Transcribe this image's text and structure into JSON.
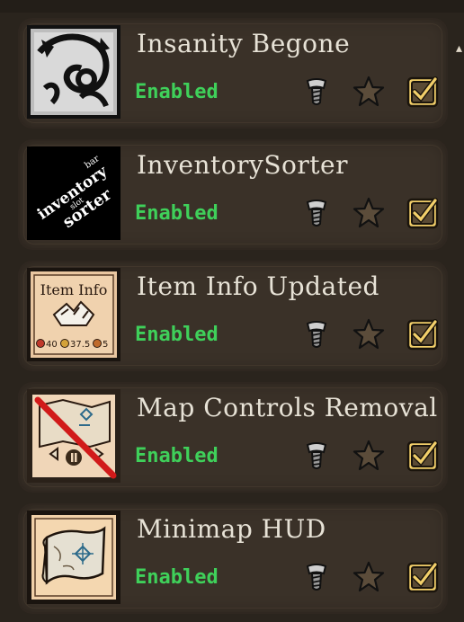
{
  "mods": [
    {
      "title": "Insanity Begone",
      "status": "Enabled",
      "thumb": "dark-creature-emblem",
      "config_icon": "screw-icon",
      "favorite_icon": "star-icon",
      "enabled_icon": "checkbox-checked-icon"
    },
    {
      "title": "InventorySorter",
      "status": "Enabled",
      "thumb": "inventory-sorter-logo",
      "logo_text": {
        "line1": "inventory",
        "line2": "bar",
        "line3": "slot",
        "line4": "sorter"
      },
      "config_icon": "screw-icon",
      "favorite_icon": "star-icon",
      "enabled_icon": "checkbox-checked-icon"
    },
    {
      "title": "Item Info Updated",
      "status": "Enabled",
      "thumb": "item-info-card",
      "card_text": {
        "heading": "Item Info",
        "n1": "40",
        "n2": "37.5",
        "n3": "5"
      },
      "config_icon": "screw-icon",
      "favorite_icon": "star-icon",
      "enabled_icon": "checkbox-checked-icon"
    },
    {
      "title": "Map Controls Removal",
      "status": "Enabled",
      "thumb": "map-controls-crossed",
      "config_icon": "screw-icon",
      "favorite_icon": "star-icon",
      "enabled_icon": "checkbox-checked-icon"
    },
    {
      "title": "Minimap HUD",
      "status": "Enabled",
      "thumb": "minimap-scroll",
      "config_icon": "screw-icon",
      "favorite_icon": "star-icon",
      "enabled_icon": "checkbox-checked-icon"
    }
  ],
  "colors": {
    "enabled": "#3fd05a",
    "title": "#e7e2d6",
    "panel": "#3a3128",
    "check_gold": "#e6b84a"
  }
}
